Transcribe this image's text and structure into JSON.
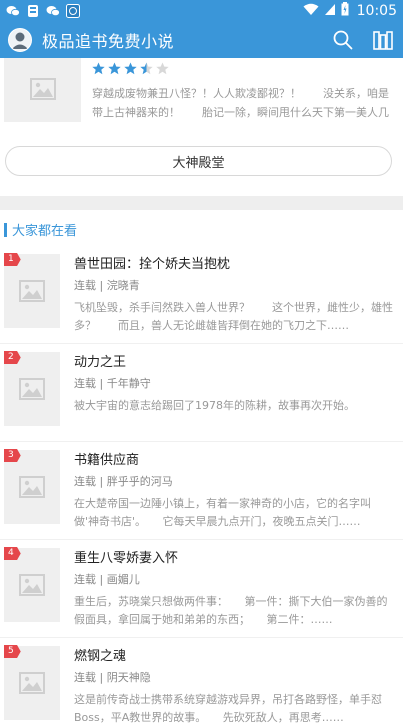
{
  "status_bar": {
    "time": "10:05",
    "left_icons": [
      "wechat-icon",
      "qq-icon",
      "wechat-icon",
      "app-icon"
    ],
    "right_icons": [
      "wifi-icon",
      "signal-icon",
      "battery-icon"
    ]
  },
  "app_bar": {
    "title": "极品追书免费小说",
    "actions": [
      "search-icon",
      "bookshelf-icon"
    ],
    "color": "#3a96d9"
  },
  "top_book": {
    "rating": 3.5,
    "max_rating": 5,
    "description": "穿越成废物兼丑八怪？！人人欺凌鄙视？！　　没关系，咱是带上古神器来的！　　胎记一除，瞬间甩什么天下第一美人几条街！！"
  },
  "master_button": {
    "label": "大神殿堂"
  },
  "section": {
    "title": "大家都在看"
  },
  "books": [
    {
      "rank": "1",
      "name": "兽世田园：拴个娇夫当抱枕",
      "status": "连载",
      "author": "浣晓青",
      "description": "飞机坠毁，杀手闫然跌入兽人世界？　　这个世界，雌性少，雄性多？　　而且，兽人无论雌雄皆拜倒在她的飞刀之下……"
    },
    {
      "rank": "2",
      "name": "动力之王",
      "status": "连载",
      "author": "千年静守",
      "description": "被大宇宙的意志给踢回了1978年的陈耕，故事再次开始。"
    },
    {
      "rank": "3",
      "name": "书籍供应商",
      "status": "连载",
      "author": "胖乎乎的河马",
      "description": "在大楚帝国一边陲小镇上，有着一家神奇的小店，它的名字叫做'神奇书店'。　　它每天早晨九点开门，夜晚五点关门……"
    },
    {
      "rank": "4",
      "name": "重生八零娇妻入怀",
      "status": "连载",
      "author": "画媚儿",
      "description": "重生后，苏晓棠只想做两件事：　　第一件：撕下大伯一家伪善的假面具，拿回属于她和弟弟的东西；　　第二件：……"
    },
    {
      "rank": "5",
      "name": "燃钢之魂",
      "status": "连载",
      "author": "阴天神隐",
      "description": "这是前传奇战士携带系统穿越游戏异界，吊打各路野怪，单手怼Boss，平A教世界的故事。　　先砍死敌人，再思考……"
    }
  ],
  "colors": {
    "accent": "#3a96d9",
    "rank_badge": "#e5474b",
    "star": "#3a96d9",
    "star_empty": "#d8d8d8"
  }
}
